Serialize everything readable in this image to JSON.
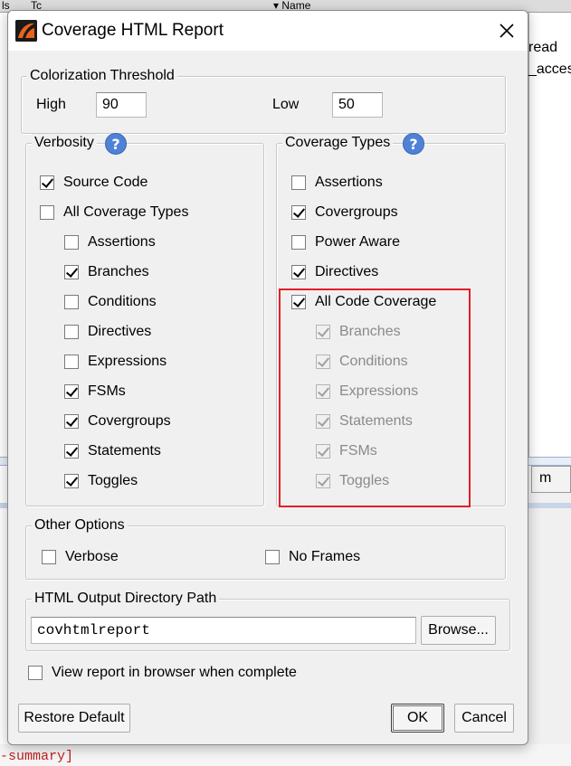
{
  "background": {
    "top_col1": "ls",
    "top_col2": "Tc",
    "top_col3": "Name",
    "right_text1": "read",
    "right_text2": "_access",
    "tab_label": "m",
    "bottom_text": "-summary]"
  },
  "dialog": {
    "title": "Coverage HTML Report",
    "icon": "app-logo-icon",
    "threshold": {
      "legend": "Colorization Threshold",
      "high_label": "High",
      "high_value": "90",
      "low_label": "Low",
      "low_value": "50"
    },
    "verbosity": {
      "legend": "Verbosity",
      "help": "?",
      "items": [
        {
          "label": "Source Code",
          "checked": true
        },
        {
          "label": "All Coverage Types",
          "checked": false
        },
        {
          "label": "Assertions",
          "checked": false
        },
        {
          "label": "Branches",
          "checked": true
        },
        {
          "label": "Conditions",
          "checked": false
        },
        {
          "label": "Directives",
          "checked": false
        },
        {
          "label": "Expressions",
          "checked": false
        },
        {
          "label": "FSMs",
          "checked": true
        },
        {
          "label": "Covergroups",
          "checked": true
        },
        {
          "label": "Statements",
          "checked": true
        },
        {
          "label": "Toggles",
          "checked": true
        }
      ]
    },
    "coverage_types": {
      "legend": "Coverage Types",
      "help": "?",
      "items": [
        {
          "label": "Assertions",
          "checked": false,
          "disabled": false
        },
        {
          "label": "Covergroups",
          "checked": true,
          "disabled": false
        },
        {
          "label": "Power Aware",
          "checked": false,
          "disabled": false
        },
        {
          "label": "Directives",
          "checked": true,
          "disabled": false
        },
        {
          "label": "All Code Coverage",
          "checked": true,
          "disabled": false
        },
        {
          "label": "Branches",
          "checked": true,
          "disabled": true
        },
        {
          "label": "Conditions",
          "checked": true,
          "disabled": true
        },
        {
          "label": "Expressions",
          "checked": true,
          "disabled": true
        },
        {
          "label": "Statements",
          "checked": true,
          "disabled": true
        },
        {
          "label": "FSMs",
          "checked": true,
          "disabled": true
        },
        {
          "label": "Toggles",
          "checked": true,
          "disabled": true
        }
      ]
    },
    "other_options": {
      "legend": "Other Options",
      "verbose_label": "Verbose",
      "verbose_checked": false,
      "noframes_label": "No Frames",
      "noframes_checked": false
    },
    "output_dir": {
      "legend": "HTML Output Directory Path",
      "value": "covhtmlreport",
      "browse_label": "Browse..."
    },
    "view_in_browser": {
      "label": "View report in browser when complete",
      "checked": false
    },
    "buttons": {
      "restore": "Restore Default",
      "ok": "OK",
      "cancel": "Cancel"
    },
    "colors": {
      "highlight": "#e0202a",
      "help": "#4f82d6"
    }
  }
}
